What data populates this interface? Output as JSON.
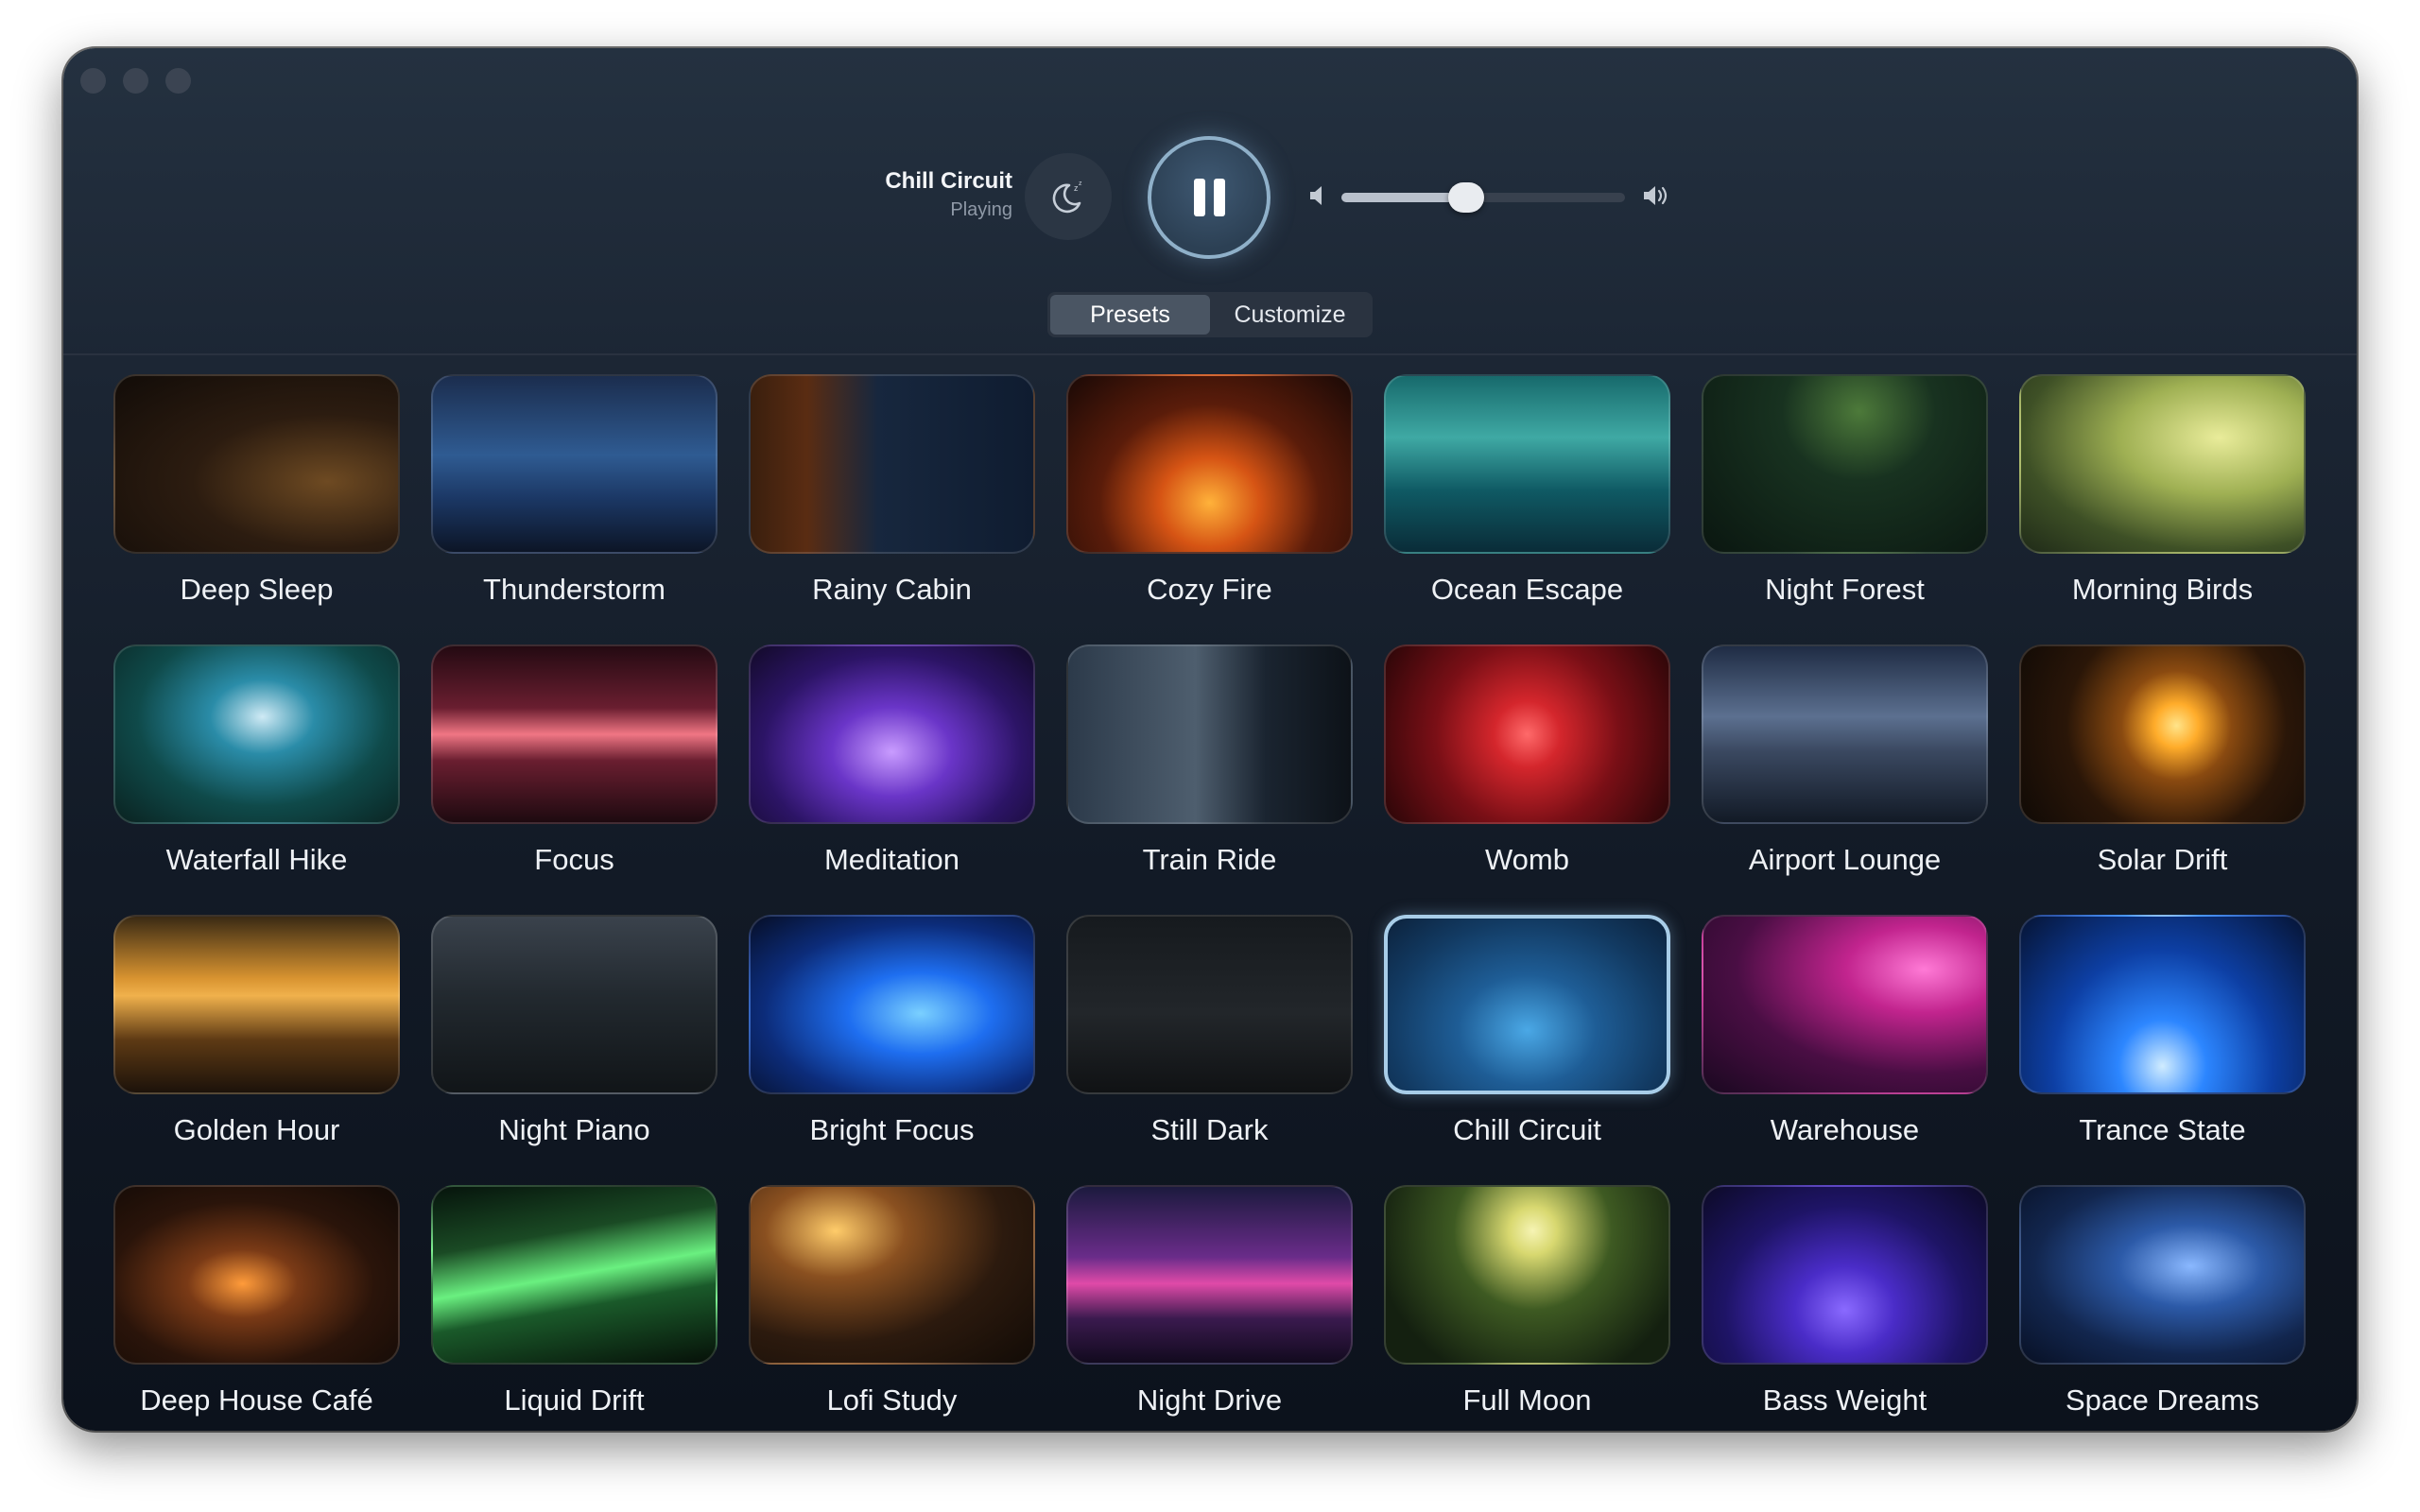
{
  "window": {
    "controls": [
      "close",
      "minimize",
      "zoom"
    ]
  },
  "now_playing": {
    "title": "Chill Circuit",
    "status": "Playing"
  },
  "transport": {
    "sleep_icon": "moon-zzz-icon",
    "play_state_icon": "pause-icon"
  },
  "volume": {
    "level": 0.44,
    "low_icon": "speaker-low-icon",
    "high_icon": "speaker-high-icon"
  },
  "tabs": [
    {
      "label": "Presets",
      "active": true
    },
    {
      "label": "Customize",
      "active": false
    }
  ],
  "presets": [
    {
      "label": "Deep Sleep",
      "bg": "radial-gradient(ellipse at 75% 60%,#6e4a22 0%,#2c1c10 45%,#120c08 100%)"
    },
    {
      "label": "Thunderstorm",
      "bg": "linear-gradient(180deg,#1b2d4e 0%,#2f5b92 45%,#1b3764 70%,#0c1526 100%)"
    },
    {
      "label": "Rainy Cabin",
      "bg": "linear-gradient(90deg,#3a1f0e 0%,#5a2c12 20%,#17273e 45%,#0f1c30 100%)"
    },
    {
      "label": "Cozy Fire",
      "bg": "radial-gradient(ellipse at 50% 72%,#ffb23a 0%,#d65414 25%,#5a1c0a 55%,#1a0906 100%)"
    },
    {
      "label": "Ocean Escape",
      "bg": "linear-gradient(180deg,#176a6c 0%,#3fa9a4 35%,#0f5a64 65%,#0a2c38 100%)"
    },
    {
      "label": "Night Forest",
      "bg": "radial-gradient(ellipse at 55% 20%,#4d7a3a 0%,#183220 35%,#0a1610 100%)"
    },
    {
      "label": "Morning Birds",
      "bg": "radial-gradient(ellipse at 70% 35%,#e9ec9a 0%,#9fb053 35%,#3e5026 70%,#1f2a18 100%)"
    },
    {
      "label": "Waterfall Hike",
      "bg": "radial-gradient(ellipse at 52% 40%,#cfeaf5 0%,#2a8ca8 25%,#0f4a4a 60%,#0a2220 100%)"
    },
    {
      "label": "Focus",
      "bg": "linear-gradient(180deg,#240a12 0%,#6a1e30 35%,#f07684 50%,#6a1e30 65%,#1e0a10 100%)"
    },
    {
      "label": "Meditation",
      "bg": "radial-gradient(ellipse at 50% 60%,#c99cff 0%,#6a35c8 30%,#2c1466 65%,#120a28 100%)"
    },
    {
      "label": "Train Ride",
      "bg": "linear-gradient(90deg,#2c3a4a 0%,#4e5e6e 45%,#1a2430 70%,#0d1218 100%)"
    },
    {
      "label": "Womb",
      "bg": "radial-gradient(circle at 50% 50%,#ff6a6a 0%,#d4262c 20%,#7a0f16 55%,#2a0608 100%)"
    },
    {
      "label": "Airport Lounge",
      "bg": "linear-gradient(180deg,#1f2c44 0%,#5c7090 40%,#3a4860 60%,#121a26 100%)"
    },
    {
      "label": "Solar Drift",
      "bg": "radial-gradient(circle at 55% 45%,#ffe48a 0%,#ffac2a 12%,#8a4a10 30%,#2a1608 60%,#100a06 100%)"
    },
    {
      "label": "Golden Hour",
      "bg": "linear-gradient(180deg,#3a2a14 0%,#d89330 35%,#f0b14c 45%,#5e3a14 70%,#1c120a 100%)"
    },
    {
      "label": "Night Piano",
      "bg": "linear-gradient(180deg,#3a424c 0%,#22292f 45%,#111518 100%)"
    },
    {
      "label": "Bright Focus",
      "bg": "radial-gradient(ellipse at 60% 55%,#7ad0ff 0%,#1e6ef0 30%,#0c2c7a 65%,#060e26 100%)"
    },
    {
      "label": "Still Dark",
      "bg": "linear-gradient(180deg,#161a1e 0%,#22262a 55%,#101214 100%)"
    },
    {
      "label": "Chill Circuit",
      "bg": "radial-gradient(ellipse at 50% 65%,#4aa8e6 0%,#1e5d96 35%,#123a62 70%,#0c223c 100%)"
    },
    {
      "label": "Warehouse",
      "bg": "radial-gradient(ellipse at 78% 30%,#ff7ad6 0%,#c2248e 25%,#4a0e44 60%,#1a0820 100%)"
    },
    {
      "label": "Trance State",
      "bg": "radial-gradient(ellipse at 50% 85%,#d0ecff 0%,#2c86ff 22%,#0d3fa4 55%,#061434 100%)"
    },
    {
      "label": "Deep House Café",
      "bg": "radial-gradient(ellipse at 45% 55%,#ff9b3a 0%,#7a3a16 25%,#2a140a 60%,#120a06 100%)"
    },
    {
      "label": "Liquid Drift",
      "bg": "linear-gradient(170deg,#06140c 0%,#1a4a24 30%,#6af080 50%,#1a5a2a 65%,#061008 100%)"
    },
    {
      "label": "Lofi Study",
      "bg": "radial-gradient(ellipse at 30% 25%,#ffcc6a 0%,#8a5020 25%,#2c1a0e 60%,#120b06 100%)"
    },
    {
      "label": "Night Drive",
      "bg": "linear-gradient(180deg,#1c1a3e 0%,#6a2c8a 40%,#e04aa8 55%,#3a1a4e 75%,#120a1e 100%)"
    },
    {
      "label": "Full Moon",
      "bg": "radial-gradient(circle at 52% 25%,#f6f4b4 0%,#d8d870 12%,#3e5a22 40%,#142010 80%)"
    },
    {
      "label": "Bass Weight",
      "bg": "radial-gradient(ellipse at 50% 70%,#8a6aff 0%,#4a2cc8 25%,#1e1466 60%,#0c0a26 100%)"
    },
    {
      "label": "Space Dreams",
      "bg": "radial-gradient(ellipse at 60% 45%,#8ab8ff 0%,#2c5aa8 30%,#12264e 65%,#081024 100%)"
    }
  ],
  "selected_preset": "Chill Circuit"
}
